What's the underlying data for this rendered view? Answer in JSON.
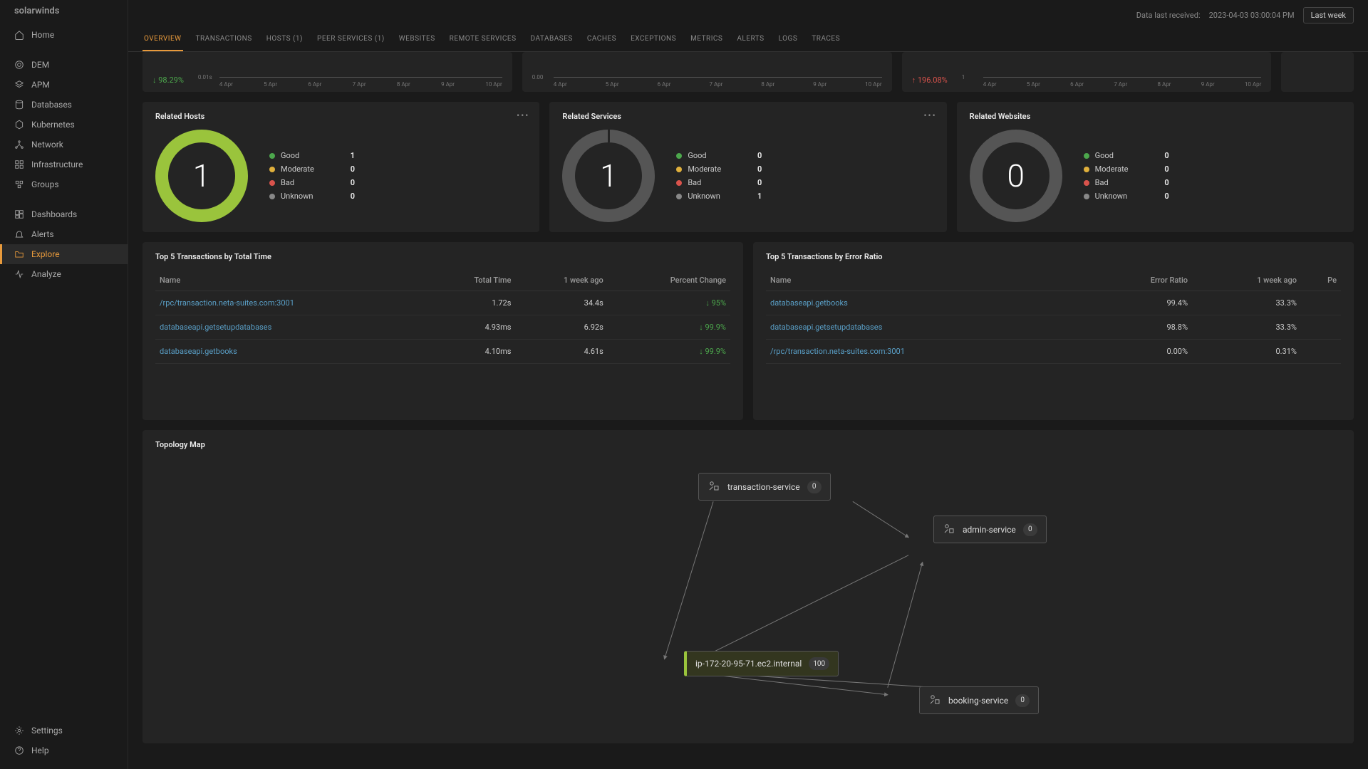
{
  "brand": "solarwinds",
  "meta": {
    "data_last_received_label": "Data last received:",
    "data_last_received_value": "2023-04-03 03:00:04 PM",
    "range": "Last week"
  },
  "sidebar": {
    "items": [
      {
        "label": "Home",
        "icon": "home"
      },
      {
        "label": "DEM",
        "icon": "target"
      },
      {
        "label": "APM",
        "icon": "layers"
      },
      {
        "label": "Databases",
        "icon": "database"
      },
      {
        "label": "Kubernetes",
        "icon": "hex"
      },
      {
        "label": "Network",
        "icon": "network"
      },
      {
        "label": "Infrastructure",
        "icon": "grid"
      },
      {
        "label": "Groups",
        "icon": "groups"
      },
      {
        "label": "Dashboards",
        "icon": "dash"
      },
      {
        "label": "Alerts",
        "icon": "bell"
      },
      {
        "label": "Explore",
        "icon": "folder"
      },
      {
        "label": "Analyze",
        "icon": "pulse"
      }
    ],
    "bottom": [
      {
        "label": "Settings",
        "icon": "gear"
      },
      {
        "label": "Help",
        "icon": "help"
      }
    ]
  },
  "tabs": [
    "OVERVIEW",
    "TRANSACTIONS",
    "HOSTS (1)",
    "PEER SERVICES (1)",
    "WEBSITES",
    "REMOTE SERVICES",
    "DATABASES",
    "CACHES",
    "EXCEPTIONS",
    "METRICS",
    "ALERTS",
    "LOGS",
    "TRACES"
  ],
  "mini": {
    "card1_trend": "98.29%",
    "card1_y": "0.01s",
    "card2_y": "0.00",
    "card3_trend": "196.08%",
    "card3_y": "1",
    "ticks": [
      "4 Apr",
      "5 Apr",
      "6 Apr",
      "7 Apr",
      "8 Apr",
      "9 Apr",
      "10 Apr"
    ]
  },
  "related": {
    "hosts": {
      "title": "Related Hosts",
      "count": "1",
      "legend": [
        {
          "label": "Good",
          "value": "1",
          "dot": "good"
        },
        {
          "label": "Moderate",
          "value": "0",
          "dot": "moderate"
        },
        {
          "label": "Bad",
          "value": "0",
          "dot": "bad"
        },
        {
          "label": "Unknown",
          "value": "0",
          "dot": "unknown"
        }
      ]
    },
    "services": {
      "title": "Related Services",
      "count": "1",
      "legend": [
        {
          "label": "Good",
          "value": "0",
          "dot": "good"
        },
        {
          "label": "Moderate",
          "value": "0",
          "dot": "moderate"
        },
        {
          "label": "Bad",
          "value": "0",
          "dot": "bad"
        },
        {
          "label": "Unknown",
          "value": "1",
          "dot": "unknown"
        }
      ]
    },
    "websites": {
      "title": "Related Websites",
      "count": "0",
      "legend": [
        {
          "label": "Good",
          "value": "0",
          "dot": "good"
        },
        {
          "label": "Moderate",
          "value": "0",
          "dot": "moderate"
        },
        {
          "label": "Bad",
          "value": "0",
          "dot": "bad"
        },
        {
          "label": "Unknown",
          "value": "0",
          "dot": "unknown"
        }
      ]
    }
  },
  "table_time": {
    "title": "Top 5 Transactions by Total Time",
    "headers": [
      "Name",
      "Total Time",
      "1 week ago",
      "Percent Change"
    ],
    "rows": [
      {
        "name": "/rpc/transaction.neta-suites.com:3001",
        "total": "1.72s",
        "ago": "34.4s",
        "pct": "95%",
        "dir": "down"
      },
      {
        "name": "databaseapi.getsetupdatabases",
        "total": "4.93ms",
        "ago": "6.92s",
        "pct": "99.9%",
        "dir": "down"
      },
      {
        "name": "databaseapi.getbooks",
        "total": "4.10ms",
        "ago": "4.61s",
        "pct": "99.9%",
        "dir": "down"
      }
    ]
  },
  "table_error": {
    "title": "Top 5 Transactions by Error Ratio",
    "headers": [
      "Name",
      "Error Ratio",
      "1 week ago",
      "Pe"
    ],
    "rows": [
      {
        "name": "databaseapi.getbooks",
        "ratio": "99.4%",
        "ago": "33.3%"
      },
      {
        "name": "databaseapi.getsetupdatabases",
        "ratio": "98.8%",
        "ago": "33.3%"
      },
      {
        "name": "/rpc/transaction.neta-suites.com:3001",
        "ratio": "0.00%",
        "ago": "0.31%"
      }
    ]
  },
  "topology": {
    "title": "Topology Map",
    "nodes": {
      "transaction": {
        "label": "transaction-service",
        "badge": "0"
      },
      "admin": {
        "label": "admin-service",
        "badge": "0"
      },
      "host": {
        "label": "ip-172-20-95-71.ec2.internal",
        "badge": "100"
      },
      "booking": {
        "label": "booking-service",
        "badge": "0"
      }
    }
  },
  "chart_data": [
    {
      "type": "line",
      "title": "",
      "x": [
        "4 Apr",
        "5 Apr",
        "6 Apr",
        "7 Apr",
        "8 Apr",
        "9 Apr",
        "10 Apr"
      ],
      "values": [
        0,
        0,
        0,
        0,
        0,
        0,
        0
      ],
      "ylabel": "0.01s",
      "trend_pct": -98.29
    },
    {
      "type": "line",
      "title": "",
      "x": [
        "4 Apr",
        "5 Apr",
        "6 Apr",
        "7 Apr",
        "8 Apr",
        "9 Apr",
        "10 Apr"
      ],
      "values": [
        0,
        0,
        0,
        0,
        0,
        0,
        0
      ],
      "ylabel": "0.00"
    },
    {
      "type": "line",
      "title": "",
      "x": [
        "4 Apr",
        "5 Apr",
        "6 Apr",
        "7 Apr",
        "8 Apr",
        "9 Apr",
        "10 Apr"
      ],
      "values": [
        0,
        0,
        0,
        0,
        0,
        0,
        0
      ],
      "ylabel": "1",
      "trend_pct": 196.08
    }
  ]
}
